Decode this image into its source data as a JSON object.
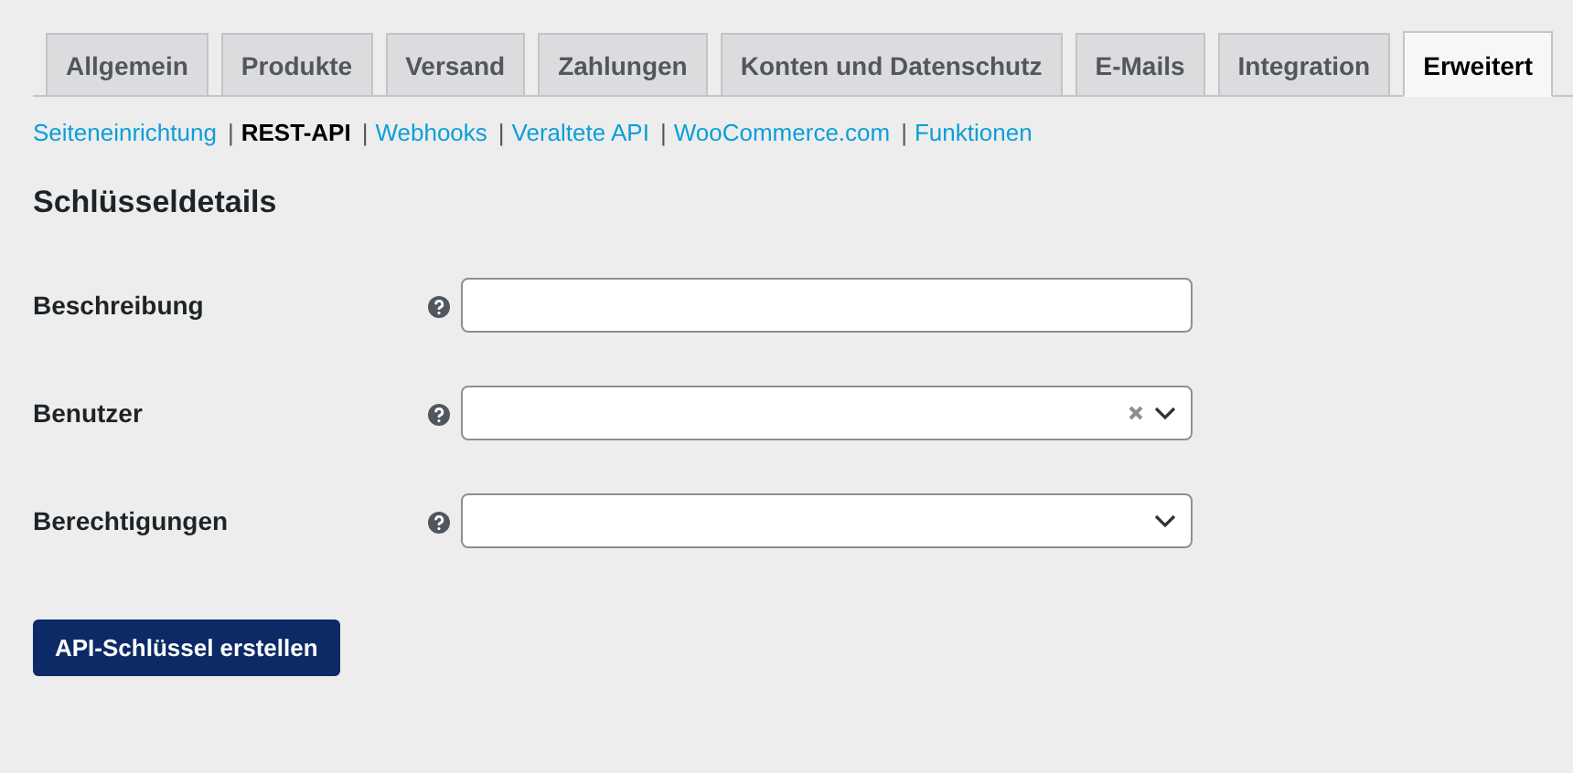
{
  "tabs": [
    {
      "label": "Allgemein",
      "selected": false
    },
    {
      "label": "Produkte",
      "selected": false
    },
    {
      "label": "Versand",
      "selected": false
    },
    {
      "label": "Zahlungen",
      "selected": false
    },
    {
      "label": "Konten und Datenschutz",
      "selected": false
    },
    {
      "label": "E-Mails",
      "selected": false
    },
    {
      "label": "Integration",
      "selected": false
    },
    {
      "label": "Erweitert",
      "selected": true
    }
  ],
  "sections": [
    {
      "label": "Seiteneinrichtung",
      "selected": false
    },
    {
      "separator": "|",
      "label": "REST-API",
      "selected": true
    },
    {
      "separator": "|",
      "label": "Webhooks",
      "selected": false
    },
    {
      "separator": "|",
      "label": "Veraltete API",
      "selected": false
    },
    {
      "separator": "|",
      "label": "WooCommerce.com",
      "selected": false
    },
    {
      "separator": "|",
      "label": "Funktionen",
      "selected": false
    }
  ],
  "heading": "Schlüsseldetails",
  "fields": [
    {
      "label": "Beschreibung",
      "kind": "text"
    },
    {
      "label": "Benutzer",
      "kind": "clearable-select"
    },
    {
      "label": "Berechtigungen",
      "kind": "select"
    }
  ],
  "submit": "API-Schlüssel erstellen"
}
